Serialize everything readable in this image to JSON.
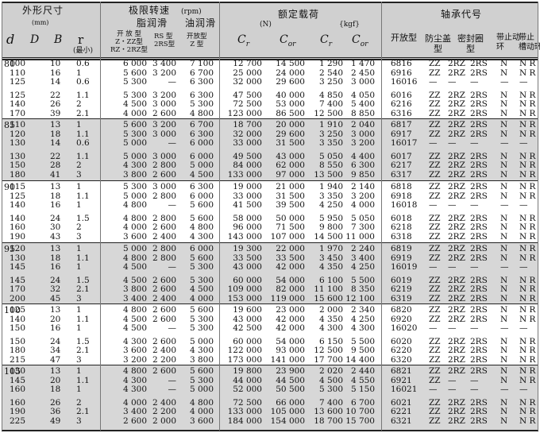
{
  "header": {
    "dims_title": "外形尺寸",
    "dims_unit": "(mm)",
    "d": "d",
    "D": "D",
    "B": "B",
    "r": "r",
    "r_note": "(最小)",
    "speed_title": "极限转速",
    "speed_unit": "(rpm)",
    "grease": "脂润滑",
    "oil": "油润滑",
    "grease_open": "开 放 型\nZ・ZZ型\nRZ・2RZ型",
    "grease_rs": "RS 型\n2RS型",
    "oil_types": "开放型\nZ 型",
    "load_title": "额定载荷",
    "load_unit_n": "(N)",
    "load_unit_kgf": "{kgf}",
    "cr": "C",
    "cr_sub": "r",
    "cor": "C",
    "cor_sub": "or",
    "code_title": "轴承代号",
    "code_open": "开放型",
    "code_dust": "防尘盖\n型",
    "code_seal": "密封圈\n型",
    "code_snap": "带止动\n环",
    "code_groove": "带止\n槽动环"
  },
  "groups": [
    {
      "d": "80",
      "rows": [
        [
          "100",
          "10",
          "0.6",
          "6 000",
          "3 400",
          "7 100",
          "12 700",
          "14 500",
          "1 290",
          "1 470",
          "6816",
          "ZZ",
          "2RZ",
          "2RS",
          "N",
          "N R"
        ],
        [
          "110",
          "16",
          "1",
          "5 600",
          "3 200",
          "6 700",
          "25 000",
          "24 000",
          "2 540",
          "2 450",
          "6916",
          "ZZ",
          "2RZ",
          "2RS",
          "N",
          "N R"
        ],
        [
          "125",
          "14",
          "0.6",
          "5 300",
          "—",
          "6 300",
          "32 000",
          "29 600",
          "3 250",
          "3 000",
          "16016",
          "—",
          "—",
          "—",
          "—",
          "—"
        ],
        [
          "125",
          "22",
          "1.1",
          "5 300",
          "3 200",
          "6 300",
          "47 500",
          "40 000",
          "4 850",
          "4 050",
          "6016",
          "ZZ",
          "2RZ",
          "2RS",
          "N",
          "N R"
        ],
        [
          "140",
          "26",
          "2",
          "4 500",
          "3 000",
          "5 300",
          "72 500",
          "53 000",
          "7 400",
          "5 400",
          "6216",
          "ZZ",
          "2RZ",
          "2RS",
          "N",
          "N R"
        ],
        [
          "170",
          "39",
          "2.1",
          "4 000",
          "2 600",
          "4 800",
          "123 000",
          "86 500",
          "12 500",
          "8 850",
          "6316",
          "ZZ",
          "2RZ",
          "2RS",
          "N",
          "N R"
        ]
      ]
    },
    {
      "d": "85",
      "rows": [
        [
          "110",
          "13",
          "1",
          "5 600",
          "3 200",
          "6 700",
          "18 700",
          "20 000",
          "1 910",
          "2 040",
          "6817",
          "ZZ",
          "2RZ",
          "2RS",
          "N",
          "N R"
        ],
        [
          "120",
          "18",
          "1.1",
          "5 300",
          "3 000",
          "6 300",
          "32 000",
          "29 600",
          "3 250",
          "3 000",
          "6917",
          "ZZ",
          "2RZ",
          "2RS",
          "N",
          "N R"
        ],
        [
          "130",
          "14",
          "0.6",
          "5 000",
          "—",
          "6 000",
          "33 000",
          "31 500",
          "3 350",
          "3 200",
          "16017",
          "—",
          "—",
          "—",
          "—",
          "—"
        ],
        [
          "130",
          "22",
          "1.1",
          "5 000",
          "3 000",
          "6 000",
          "49 500",
          "43 000",
          "5 050",
          "4 400",
          "6017",
          "ZZ",
          "2RZ",
          "2RS",
          "N",
          "N R"
        ],
        [
          "150",
          "28",
          "2",
          "4 300",
          "2 800",
          "5 000",
          "84 000",
          "62 000",
          "8 550",
          "6 300",
          "6217",
          "ZZ",
          "2RZ",
          "2RS",
          "N",
          "N R"
        ],
        [
          "180",
          "41",
          "3",
          "3 800",
          "2 600",
          "4 500",
          "133 000",
          "97 000",
          "13 500",
          "9 850",
          "6317",
          "ZZ",
          "2RZ",
          "2RS",
          "N",
          "N R"
        ]
      ]
    },
    {
      "d": "90",
      "rows": [
        [
          "115",
          "13",
          "1",
          "5 300",
          "3 000",
          "6 300",
          "19 000",
          "21 000",
          "1 940",
          "2 140",
          "6818",
          "ZZ",
          "2RZ",
          "2RS",
          "N",
          "N R"
        ],
        [
          "125",
          "18",
          "1.1",
          "5 000",
          "2 800",
          "6 000",
          "33 000",
          "31 500",
          "3 350",
          "3 200",
          "6918",
          "ZZ",
          "2RZ",
          "2RS",
          "N",
          "N R"
        ],
        [
          "140",
          "16",
          "1",
          "4 800",
          "—",
          "5 600",
          "41 500",
          "39 500",
          "4 250",
          "4 000",
          "16018",
          "—",
          "—",
          "—",
          "—",
          "—"
        ],
        [
          "140",
          "24",
          "1.5",
          "4 800",
          "2 800",
          "5 600",
          "58 000",
          "50 000",
          "5 950",
          "5 050",
          "6018",
          "ZZ",
          "2RZ",
          "2RS",
          "N",
          "N R"
        ],
        [
          "160",
          "30",
          "2",
          "4 000",
          "2 600",
          "4 800",
          "96 000",
          "71 500",
          "9 800",
          "7 300",
          "6218",
          "ZZ",
          "2RZ",
          "2RS",
          "N",
          "N R"
        ],
        [
          "190",
          "43",
          "3",
          "3 600",
          "2 400",
          "4 300",
          "143 000",
          "107 000",
          "14 500",
          "11 000",
          "6318",
          "ZZ",
          "2RZ",
          "2RS",
          "N",
          "N R"
        ]
      ]
    },
    {
      "d": "95",
      "rows": [
        [
          "120",
          "13",
          "1",
          "5 000",
          "2 800",
          "6 000",
          "19 300",
          "22 000",
          "1 970",
          "2 240",
          "6819",
          "ZZ",
          "2RZ",
          "2RS",
          "N",
          "N R"
        ],
        [
          "130",
          "18",
          "1.1",
          "4 800",
          "2 800",
          "5 600",
          "33 500",
          "33 500",
          "3 450",
          "3 400",
          "6919",
          "ZZ",
          "2RZ",
          "2RS",
          "N",
          "N R"
        ],
        [
          "145",
          "16",
          "1",
          "4 500",
          "—",
          "5 300",
          "43 000",
          "42 000",
          "4 350",
          "4 250",
          "16019",
          "—",
          "—",
          "—",
          "—",
          "—"
        ],
        [
          "145",
          "24",
          "1.5",
          "4 500",
          "2 600",
          "5 300",
          "60 000",
          "54 000",
          "6 100",
          "5 500",
          "6019",
          "ZZ",
          "2RZ",
          "2RS",
          "N",
          "N R"
        ],
        [
          "170",
          "32",
          "2.1",
          "3 800",
          "2 600",
          "4 500",
          "109 000",
          "82 000",
          "11 100",
          "8 350",
          "6219",
          "ZZ",
          "2RZ",
          "2RS",
          "N",
          "N R"
        ],
        [
          "200",
          "45",
          "3",
          "3 400",
          "2 400",
          "4 000",
          "153 000",
          "119 000",
          "15 600",
          "12 100",
          "6319",
          "ZZ",
          "2RZ",
          "2RS",
          "N",
          "N R"
        ]
      ]
    },
    {
      "d": "100",
      "rows": [
        [
          "125",
          "13",
          "1",
          "4 800",
          "2 600",
          "5 600",
          "19 600",
          "23 000",
          "2 000",
          "2 340",
          "6820",
          "ZZ",
          "2RZ",
          "2RS",
          "N",
          "N R"
        ],
        [
          "140",
          "20",
          "1.1",
          "4 500",
          "2 600",
          "5 300",
          "43 000",
          "42 000",
          "4 350",
          "4 250",
          "6920",
          "ZZ",
          "2RZ",
          "2RS",
          "N",
          "N R"
        ],
        [
          "150",
          "16",
          "1",
          "4 500",
          "—",
          "5 300",
          "42 500",
          "42 000",
          "4 300",
          "4 300",
          "16020",
          "—",
          "—",
          "—",
          "—",
          "—"
        ],
        [
          "150",
          "24",
          "1.5",
          "4 300",
          "2 600",
          "5 000",
          "60 000",
          "54 000",
          "6 150",
          "5 500",
          "6020",
          "ZZ",
          "2RZ",
          "2RS",
          "N",
          "N R"
        ],
        [
          "180",
          "34",
          "2.1",
          "3 600",
          "2 400",
          "4 300",
          "122 000",
          "93 000",
          "12 500",
          "9 500",
          "6220",
          "ZZ",
          "2RZ",
          "2RS",
          "N",
          "N R"
        ],
        [
          "215",
          "47",
          "3",
          "3 200",
          "2 200",
          "3 800",
          "173 000",
          "141 000",
          "17 700",
          "14 400",
          "6320",
          "ZZ",
          "2RZ",
          "2RS",
          "N",
          "N R"
        ]
      ]
    },
    {
      "d": "105",
      "rows": [
        [
          "130",
          "13",
          "1",
          "4 800",
          "2 600",
          "5 600",
          "19 800",
          "23 900",
          "2 020",
          "2 440",
          "6821",
          "ZZ",
          "2RZ",
          "2RS",
          "N",
          "N R"
        ],
        [
          "145",
          "20",
          "1.1",
          "4 300",
          "—",
          "5 300",
          "44 000",
          "44 500",
          "4 500",
          "4 550",
          "6921",
          "ZZ",
          "—",
          "—",
          "N",
          "N R"
        ],
        [
          "160",
          "18",
          "1",
          "4 300",
          "—",
          "5 000",
          "52 000",
          "50 500",
          "5 300",
          "5 150",
          "16021",
          "—",
          "—",
          "—",
          "—",
          "—"
        ],
        [
          "160",
          "26",
          "2",
          "4 000",
          "2 400",
          "4 800",
          "72 500",
          "66 000",
          "7 400",
          "6 700",
          "6021",
          "ZZ",
          "2RZ",
          "2RS",
          "N",
          "N R"
        ],
        [
          "190",
          "36",
          "2.1",
          "3 400",
          "2 200",
          "4 000",
          "133 000",
          "105 000",
          "13 600",
          "10 700",
          "6221",
          "ZZ",
          "2RZ",
          "2RS",
          "N",
          "N R"
        ],
        [
          "225",
          "49",
          "3",
          "2 600",
          "2 000",
          "3 600",
          "184 000",
          "154 000",
          "18 700",
          "15 700",
          "6321",
          "ZZ",
          "2RZ",
          "2RS",
          "N",
          "N R"
        ]
      ]
    }
  ]
}
